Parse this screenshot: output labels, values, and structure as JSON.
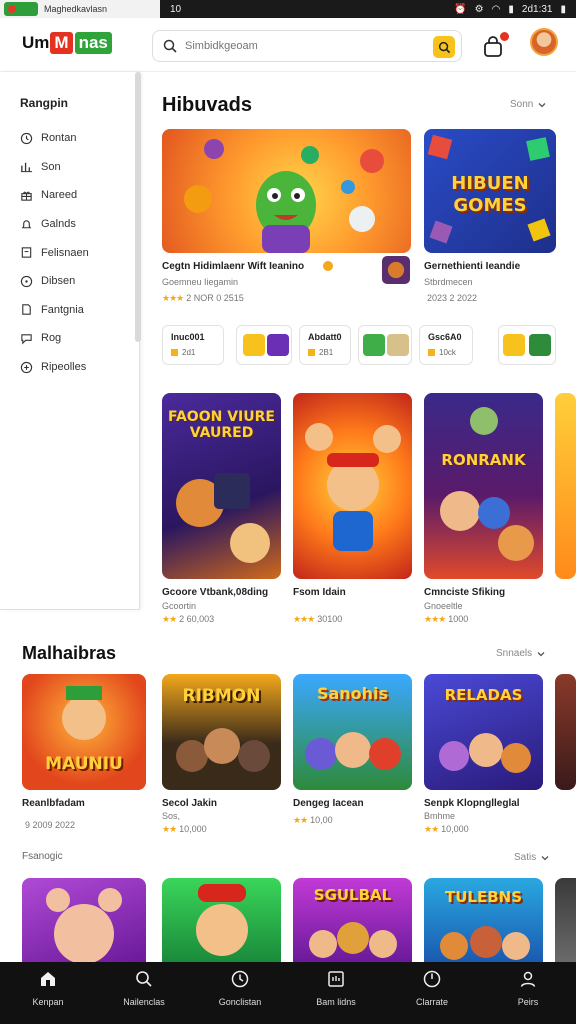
{
  "status_bar": {
    "url": "Maghedkavlasn",
    "time_left": "10",
    "time_right": "2d1:31"
  },
  "header": {
    "logo": {
      "part1": "Um",
      "part2": "M",
      "part3": "nas"
    },
    "search_placeholder": "Simbidkgeoam"
  },
  "sidebar": {
    "title": "Rangpin",
    "items": [
      {
        "label": "Rontan",
        "icon": "clock-icon"
      },
      {
        "label": "Son",
        "icon": "chart-icon"
      },
      {
        "label": "Nareed",
        "icon": "gift-icon"
      },
      {
        "label": "Galnds",
        "icon": "bell-icon"
      },
      {
        "label": "Felisnaen",
        "icon": "bookmark-icon"
      },
      {
        "label": "Dibsen",
        "icon": "compass-icon"
      },
      {
        "label": "Fantgnia",
        "icon": "tag-icon"
      },
      {
        "label": "Rog",
        "icon": "chat-icon"
      },
      {
        "label": "Ripeolles",
        "icon": "plus-circle-icon"
      }
    ]
  },
  "section1": {
    "title": "Hibuvads",
    "link": "Sonn",
    "featured": [
      {
        "title": "Cegtn Hidimlaenr Wift Ieanino",
        "sub": "Goemneu Iiegamin",
        "stars": "★★★",
        "meta": "2 NOR 0 2515",
        "art_text": ""
      },
      {
        "title": "Gernethienti Ieandie",
        "sub": "Stbrdmecen",
        "stars": "",
        "meta": "2023 2 2022",
        "art_text": "HIBUEN GOMES"
      }
    ],
    "chips": [
      {
        "l1": "Inuc001",
        "l2": "2d1"
      },
      {
        "l1": "Abdatt0",
        "l2": "2B1"
      },
      {
        "l1": "Gsc6A0",
        "l2": "10ck"
      }
    ],
    "grid": [
      {
        "title": "Gcoore Vtbank,08ding",
        "sub": "Gcoortin",
        "stars": "★★",
        "meta": "2 60,003",
        "art_text": "FAOON VIURE VAURED"
      },
      {
        "title": "Fsom Idain",
        "sub": "",
        "stars": "★★★",
        "meta": "30100",
        "art_text": ""
      },
      {
        "title": "Cmnciste Sfiking",
        "sub": "Gnoeeltle",
        "stars": "★★★",
        "meta": "1000",
        "art_text": "RONRANK"
      }
    ]
  },
  "section2": {
    "title": "Malhaibras",
    "link": "Snnaels",
    "items": [
      {
        "title": "Reanlbfadam",
        "sub": "",
        "stars": "",
        "meta": "9 2009 2022",
        "art_text": "MAUNIU"
      },
      {
        "title": "Secol Jakin",
        "sub": "Sos,",
        "stars": "★★",
        "meta": "10,000",
        "art_text": "RIBMON"
      },
      {
        "title": "Dengeg Iacean",
        "sub": "",
        "stars": "★★",
        "meta": "10,00",
        "art_text": "Sanohis"
      },
      {
        "title": "Senpk Klopnglleglal",
        "sub": "Bmhme",
        "stars": "★★",
        "meta": "10,000",
        "art_text": "RELADAS"
      }
    ]
  },
  "section3": {
    "title": "Fsanogic",
    "link": "Satis",
    "items": [
      {
        "art_text": ""
      },
      {
        "art_text": ""
      },
      {
        "art_text": "SGULBAL"
      },
      {
        "art_text": "TULEBNS"
      }
    ]
  },
  "bottom_nav": [
    {
      "label": "Kenpan",
      "icon": "home-icon"
    },
    {
      "label": "Nailenclas",
      "icon": "search-icon"
    },
    {
      "label": "Gonclistan",
      "icon": "clock-icon"
    },
    {
      "label": "Bam lidns",
      "icon": "library-icon"
    },
    {
      "label": "Clarrate",
      "icon": "compass-icon"
    },
    {
      "label": "Peirs",
      "icon": "profile-icon"
    }
  ],
  "colors": {
    "accent_yellow": "#f6c21b",
    "brand_red": "#e43120",
    "brand_green": "#2ea43a",
    "nav_bg": "#111111",
    "star": "#f3a81b"
  }
}
